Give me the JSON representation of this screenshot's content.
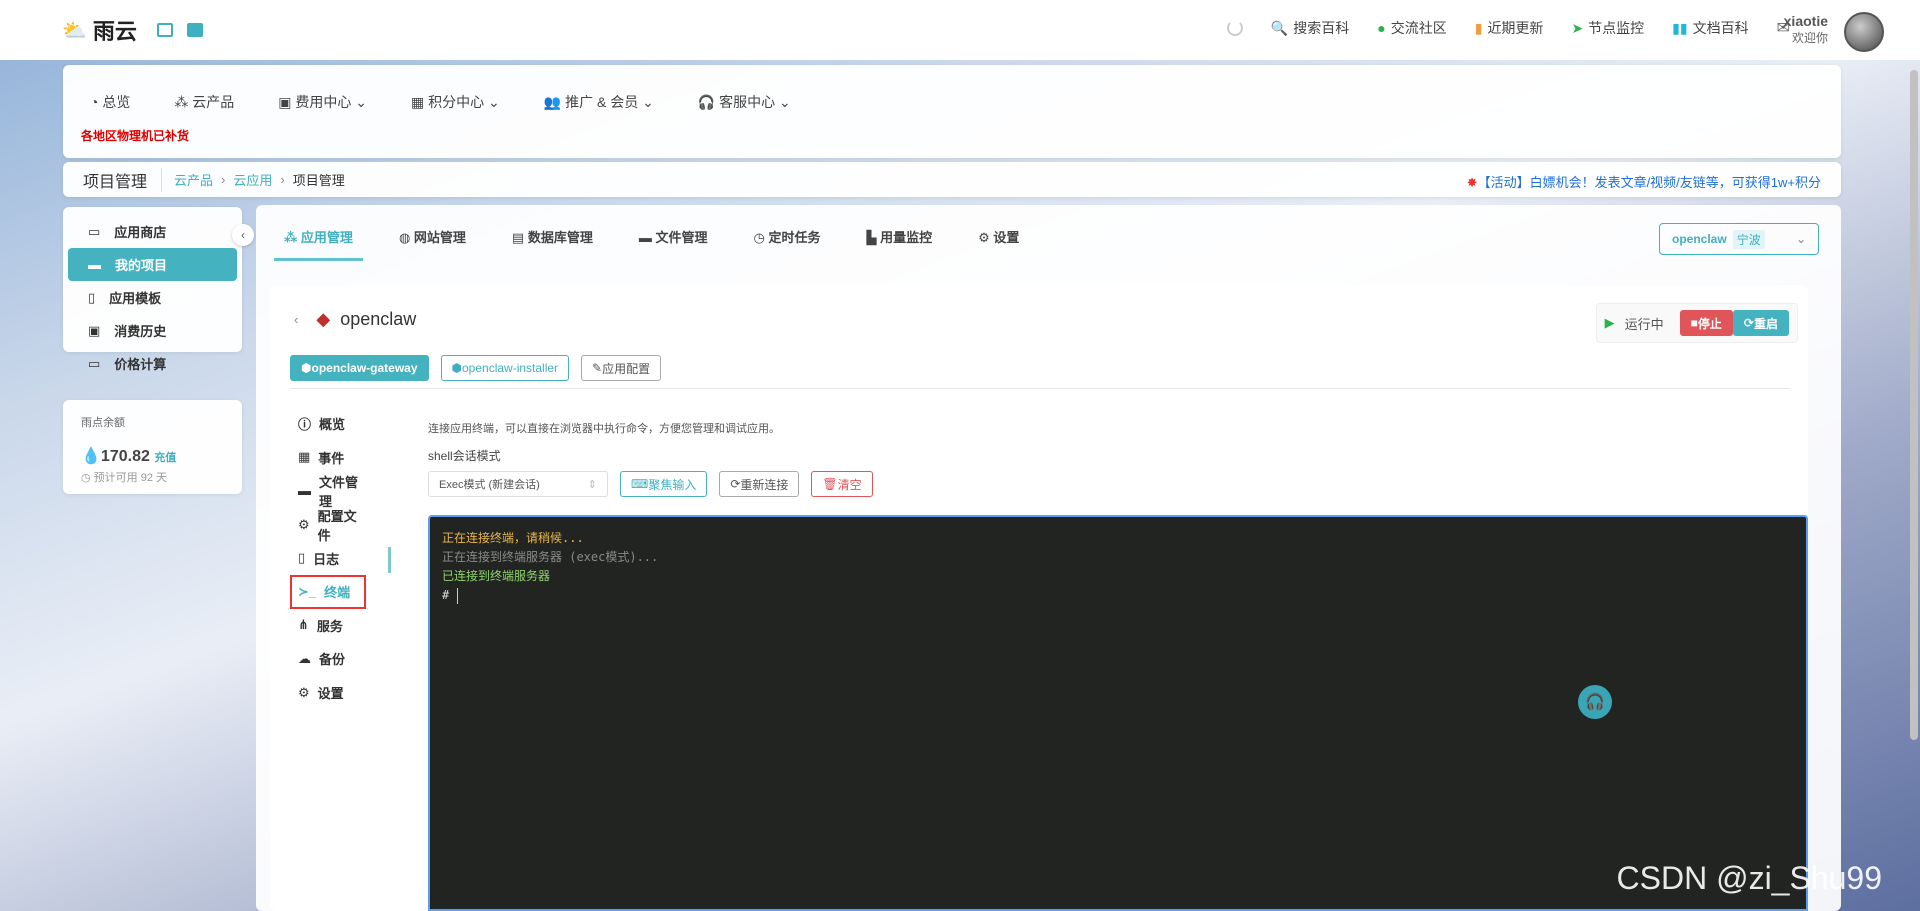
{
  "header": {
    "logo": "雨云",
    "nav": [
      {
        "icon": "spinner-icon",
        "label": ""
      },
      {
        "icon": "search-icon",
        "label": "搜索百科"
      },
      {
        "icon": "wechat-icon",
        "label": "交流社区"
      },
      {
        "icon": "book-icon",
        "label": "近期更新"
      },
      {
        "icon": "location-arrow-icon",
        "label": "节点监控"
      },
      {
        "icon": "docs-icon",
        "label": "文档百科"
      }
    ],
    "user": {
      "name": "xiaotie",
      "greeting": "欢迎你"
    }
  },
  "nav": {
    "items": [
      {
        "label": "总览",
        "icon": "dashboard-icon"
      },
      {
        "label": "云产品",
        "icon": "cubes-icon"
      },
      {
        "label": "费用中心",
        "icon": "money-icon",
        "dropdown": true
      },
      {
        "label": "积分中心",
        "icon": "gift-icon",
        "dropdown": true
      },
      {
        "label": "推广 & 会员",
        "icon": "users-icon",
        "dropdown": true
      },
      {
        "label": "客服中心",
        "icon": "headset-icon",
        "dropdown": true
      }
    ],
    "announcement": "各地区物理机已补货"
  },
  "breadcrumb": {
    "title": "项目管理",
    "items": [
      "云产品",
      "云应用",
      "项目管理"
    ],
    "activity": "【活动】白嫖机会！发表文章/视频/友链等，可获得1w+积分"
  },
  "sidebar": {
    "items": [
      {
        "label": "应用商店",
        "icon": "store-icon"
      },
      {
        "label": "我的项目",
        "icon": "folder-icon",
        "active": true
      },
      {
        "label": "应用模板",
        "icon": "file-code-icon"
      },
      {
        "label": "消费历史",
        "icon": "money-icon"
      },
      {
        "label": "价格计算",
        "icon": "calculator-icon"
      }
    ]
  },
  "balance": {
    "label": "雨点余额",
    "amount": "170.82",
    "recharge": "充值",
    "estimate": "预计可用 92 天"
  },
  "tabs": [
    {
      "label": "应用管理",
      "active": true
    },
    {
      "label": "网站管理"
    },
    {
      "label": "数据库管理"
    },
    {
      "label": "文件管理"
    },
    {
      "label": "定时任务"
    },
    {
      "label": "用量监控"
    },
    {
      "label": "设置"
    }
  ],
  "project_select": {
    "name": "openclaw",
    "region": "宁波"
  },
  "app": {
    "name": "openclaw",
    "status": "运行中",
    "stop": "停止",
    "restart": "重启",
    "containers": [
      "openclaw-gateway",
      "openclaw-installer"
    ],
    "config": "应用配置"
  },
  "menu": [
    {
      "label": "概览",
      "icon": "info-icon"
    },
    {
      "label": "事件",
      "icon": "calendar-icon"
    },
    {
      "label": "文件管理",
      "icon": "folder-open-icon"
    },
    {
      "label": "配置文件",
      "icon": "cogs-icon"
    },
    {
      "label": "日志",
      "icon": "file-icon"
    },
    {
      "label": "终端",
      "icon": "terminal-icon",
      "active": true
    },
    {
      "label": "服务",
      "icon": "network-icon"
    },
    {
      "label": "备份",
      "icon": "cloud-icon"
    },
    {
      "label": "设置",
      "icon": "gear-icon"
    }
  ],
  "terminal": {
    "description": "连接应用终端，可以直接在浏览器中执行命令，方便您管理和调试应用。",
    "mode_label": "shell会话模式",
    "mode_value": "Exec模式 (新建会话)",
    "focus": "聚焦输入",
    "reconnect": "重新连接",
    "clear": "清空",
    "lines": [
      {
        "text": "正在连接终端，请稍候...",
        "color": "#e8b64c"
      },
      {
        "text": "正在连接到终端服务器 (exec模式)...",
        "color": "#8a8a8a"
      },
      {
        "text": "已连接到终端服务器",
        "color": "#8fd46a"
      }
    ],
    "prompt": "#"
  },
  "watermark": "CSDN @zi_Shu99"
}
